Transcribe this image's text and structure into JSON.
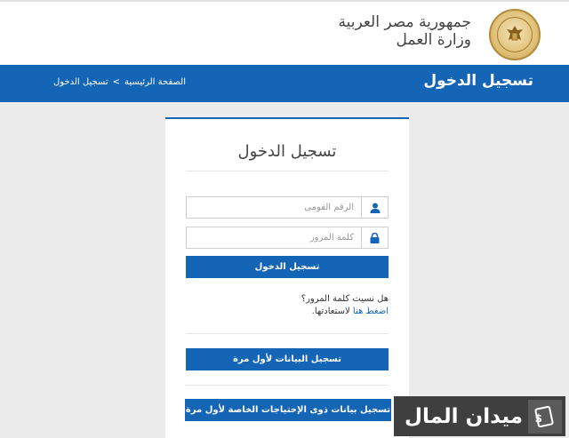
{
  "header": {
    "country": "جمهورية مصر العربية",
    "ministry": "وزارة العمل",
    "emblem_text": "Ministry of Labour"
  },
  "bar": {
    "page_title": "تسجيل الدخول",
    "breadcrumb": {
      "home": "الصفحة الرئيسية",
      "separator": ">",
      "current": "تسجيل الدخول"
    }
  },
  "login": {
    "title": "تسجيل الدخول",
    "national_id_placeholder": "الرقم القومى",
    "password_placeholder": "كلمة المرور",
    "submit_label": "تسجيل الدخول",
    "forgot_question": "هل نسيت كلمة المرور؟",
    "forgot_link": "اضغط هنا",
    "forgot_suffix": "لاستعادتها.",
    "register_first_label": "تسجيل البيانات لأول مرة",
    "register_special_label": "تسجيل بيانات ذوى الإحتياجات الخاصة لأول مرة"
  },
  "watermark": {
    "text": "ميدان المال"
  },
  "colors": {
    "primary": "#1565b6",
    "watermark_bg": "#3f3f3f"
  }
}
